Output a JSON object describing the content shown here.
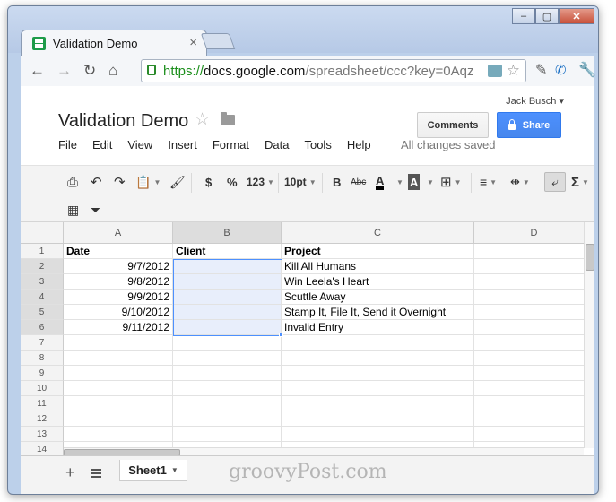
{
  "browser": {
    "tab_title": "Validation Demo",
    "tab_close": "×",
    "url_scheme": "https://",
    "url_host": "docs.google.com",
    "url_path": "/spreadsheet/ccc?key=0Aqz",
    "window_buttons": [
      "‒",
      "▢",
      "✕"
    ]
  },
  "doc": {
    "account": "Jack Busch ▾",
    "title": "Validation Demo",
    "comments_label": "Comments",
    "share_label": "Share",
    "save_status": "All changes saved",
    "menu": [
      "File",
      "Edit",
      "View",
      "Insert",
      "Format",
      "Data",
      "Tools",
      "Help"
    ]
  },
  "toolbar": {
    "currency": "$",
    "percent": "%",
    "number_format": "123",
    "font_size": "10pt",
    "bold": "B",
    "strike": "Abc",
    "text_color": "A",
    "fill_color": "A",
    "sum": "Σ"
  },
  "grid": {
    "columns": [
      "A",
      "B",
      "C",
      "D"
    ],
    "selected_column": "B",
    "row_numbers": [
      "1",
      "2",
      "3",
      "4",
      "5",
      "6",
      "7",
      "8",
      "9",
      "10",
      "11",
      "12",
      "13",
      "14"
    ],
    "rows": [
      [
        "Date",
        "Client",
        "Project",
        ""
      ],
      [
        "9/7/2012",
        "",
        "Kill All Humans",
        ""
      ],
      [
        "9/8/2012",
        "",
        "Win Leela's Heart",
        ""
      ],
      [
        "9/9/2012",
        "",
        "Scuttle Away",
        ""
      ],
      [
        "9/10/2012",
        "",
        "Stamp It, File It, Send it Overnight",
        ""
      ],
      [
        "9/11/2012",
        "",
        "Invalid Entry",
        ""
      ]
    ]
  },
  "sheets": {
    "active": "Sheet1",
    "add": "+",
    "watermark": "groovyPost.com"
  },
  "colors": {
    "selection": "#4d90fe",
    "share_button": "#4d90fe",
    "url_green": "#1c8f1c"
  }
}
